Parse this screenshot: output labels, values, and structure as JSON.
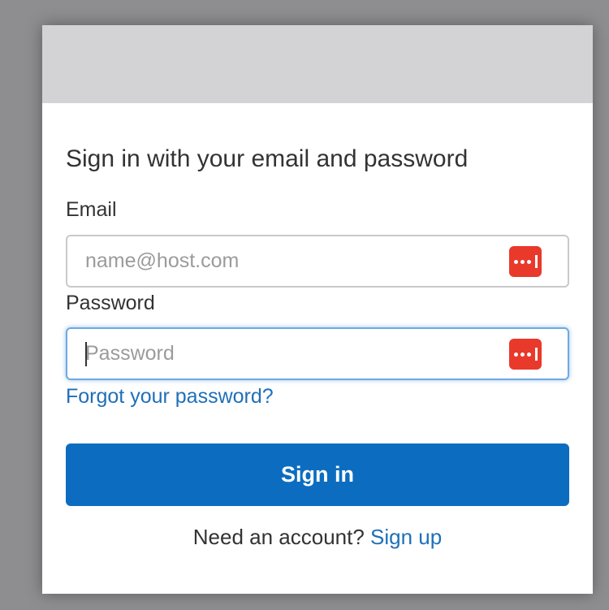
{
  "form": {
    "heading": "Sign in with your email and password",
    "email": {
      "label": "Email",
      "placeholder": "name@host.com",
      "value": ""
    },
    "password": {
      "label": "Password",
      "placeholder": "Password",
      "value": ""
    },
    "forgot_password": "Forgot your password?",
    "submit_label": "Sign in",
    "footer_text": "Need an account?",
    "signup_link": "Sign up"
  },
  "icons": {
    "password_manager": "password-manager-icon"
  },
  "colors": {
    "backdrop": "#8e8d8f",
    "banner": "#d3d2d5",
    "primary_button": "#0c6dc0",
    "link": "#1f6fb8",
    "password_manager_icon": "#e8392b",
    "focus_border": "#6fa9e0"
  }
}
